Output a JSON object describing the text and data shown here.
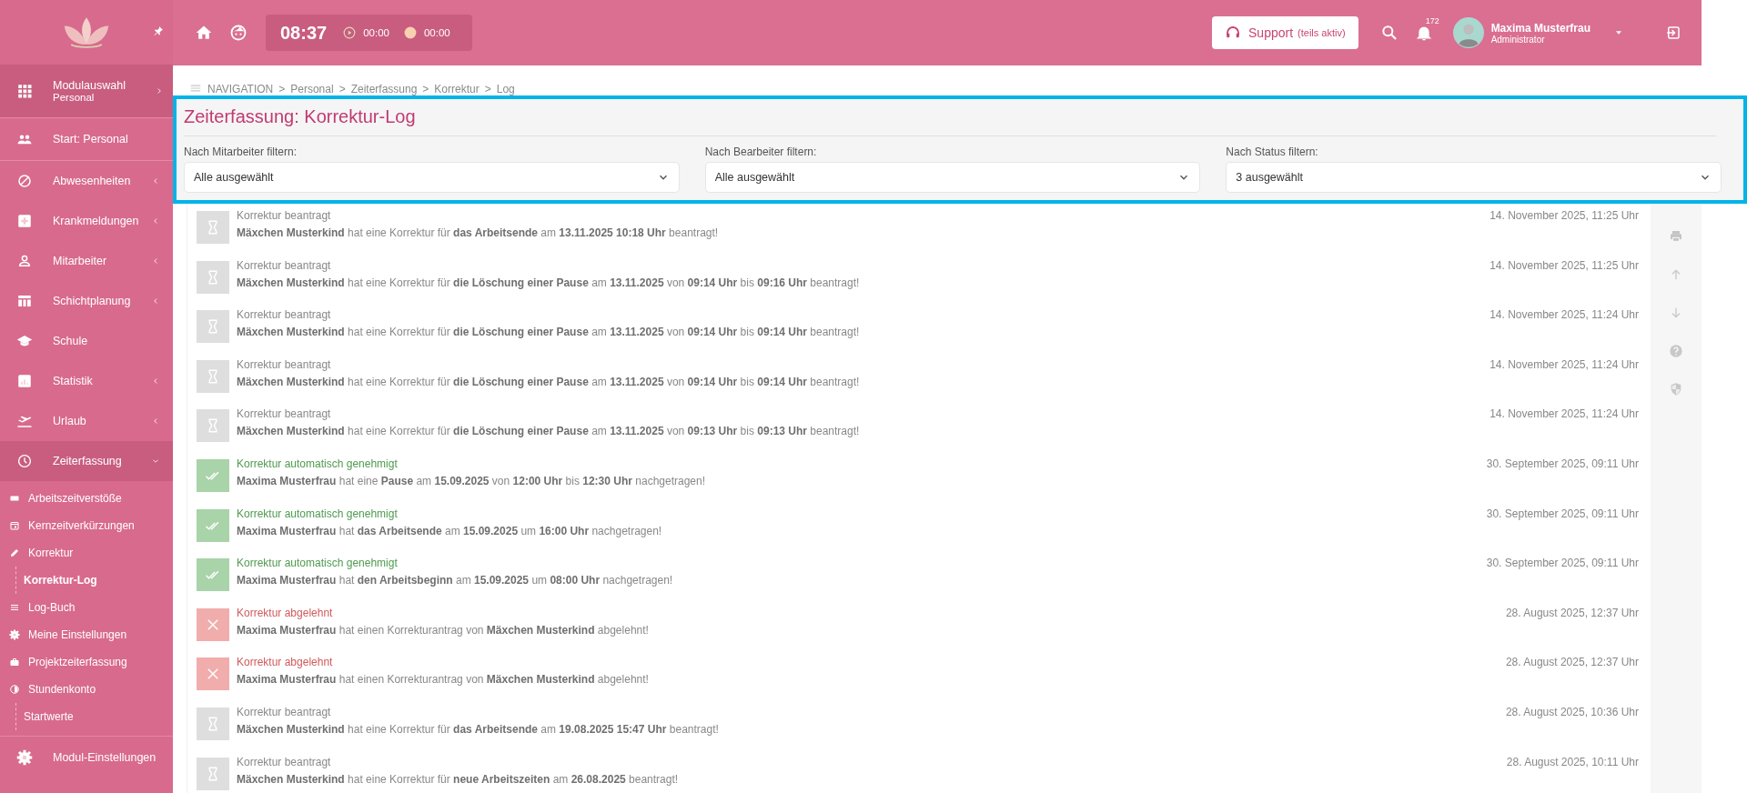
{
  "sidebar": {
    "module": {
      "label": "Modulauswahl",
      "sublabel": "Personal"
    },
    "items": [
      {
        "label": "Start: Personal",
        "expandable": false,
        "expanded": false
      },
      {
        "label": "Abwesenheiten",
        "expandable": true,
        "expanded": false
      },
      {
        "label": "Krankmeldungen",
        "expandable": true,
        "expanded": false
      },
      {
        "label": "Mitarbeiter",
        "expandable": true,
        "expanded": false
      },
      {
        "label": "Schichtplanung",
        "expandable": true,
        "expanded": false
      },
      {
        "label": "Schule",
        "expandable": false,
        "expanded": false
      },
      {
        "label": "Statistik",
        "expandable": true,
        "expanded": false
      },
      {
        "label": "Urlaub",
        "expandable": true,
        "expanded": false
      },
      {
        "label": "Zeiterfassung",
        "expandable": true,
        "expanded": true,
        "children": [
          {
            "label": "Arbeitszeitverstöße",
            "selected": false
          },
          {
            "label": "Kernzeitverkürzungen",
            "selected": false
          },
          {
            "label": "Korrektur",
            "selected": false,
            "children": [
              {
                "label": "Korrektur-Log",
                "selected": true
              }
            ]
          },
          {
            "label": "Log-Buch",
            "selected": false
          },
          {
            "label": "Meine Einstellungen",
            "selected": false
          },
          {
            "label": "Projektzeiterfassung",
            "selected": false
          },
          {
            "label": "Stundenkonto",
            "selected": false,
            "children": [
              {
                "label": "Startwerte",
                "selected": false
              }
            ]
          }
        ]
      }
    ],
    "footer_item": {
      "label": "Modul-Einstellungen"
    }
  },
  "topbar": {
    "clock": "08:37",
    "timers": [
      {
        "kind": "work",
        "value": "00:00"
      },
      {
        "kind": "break",
        "value": "00:00"
      }
    ],
    "support": {
      "label": "Support",
      "note": "(teils aktiv)"
    },
    "notifications": "172",
    "user": {
      "name": "Maxima Musterfrau",
      "role": "Administrator"
    }
  },
  "breadcrumb": {
    "items": [
      "NAVIGATION",
      "Personal",
      "Zeiterfassung",
      "Korrektur",
      "Log"
    ],
    "separator": ">"
  },
  "page_title": "Zeiterfassung: Korrektur-Log",
  "filters": [
    {
      "label": "Nach Mitarbeiter filtern:",
      "value": "Alle ausgewählt"
    },
    {
      "label": "Nach Bearbeiter filtern:",
      "value": "Alle ausgewählt"
    },
    {
      "label": "Nach Status filtern:",
      "value": "3 ausgewählt"
    }
  ],
  "log": [
    {
      "kind": "pending",
      "title": "Korrektur beantragt",
      "message": "**Mäxchen Musterkind** hat eine Korrektur für **das Arbeitsende** am **13.11.2025 10:18 Uhr** beantragt!",
      "date": "14. November 2025, 11:25 Uhr"
    },
    {
      "kind": "pending",
      "title": "Korrektur beantragt",
      "message": "**Mäxchen Musterkind** hat eine Korrektur für **die Löschung einer Pause** am **13.11.2025** von **09:14 Uhr** bis **09:16 Uhr** beantragt!",
      "date": "14. November 2025, 11:25 Uhr"
    },
    {
      "kind": "pending",
      "title": "Korrektur beantragt",
      "message": "**Mäxchen Musterkind** hat eine Korrektur für **die Löschung einer Pause** am **13.11.2025** von **09:14 Uhr** bis **09:14 Uhr** beantragt!",
      "date": "14. November 2025, 11:24 Uhr"
    },
    {
      "kind": "pending",
      "title": "Korrektur beantragt",
      "message": "**Mäxchen Musterkind** hat eine Korrektur für **die Löschung einer Pause** am **13.11.2025** von **09:14 Uhr** bis **09:14 Uhr** beantragt!",
      "date": "14. November 2025, 11:24 Uhr"
    },
    {
      "kind": "pending",
      "title": "Korrektur beantragt",
      "message": "**Mäxchen Musterkind** hat eine Korrektur für **die Löschung einer Pause** am **13.11.2025** von **09:13 Uhr** bis **09:13 Uhr** beantragt!",
      "date": "14. November 2025, 11:24 Uhr"
    },
    {
      "kind": "approved",
      "title": "Korrektur automatisch genehmigt",
      "message": "**Maxima Musterfrau** hat eine **Pause** am **15.09.2025** von **12:00 Uhr** bis **12:30 Uhr** nachgetragen!",
      "date": "30. September 2025, 09:11 Uhr"
    },
    {
      "kind": "approved",
      "title": "Korrektur automatisch genehmigt",
      "message": "**Maxima Musterfrau** hat **das Arbeitsende** am **15.09.2025** um **16:00 Uhr** nachgetragen!",
      "date": "30. September 2025, 09:11 Uhr"
    },
    {
      "kind": "approved",
      "title": "Korrektur automatisch genehmigt",
      "message": "**Maxima Musterfrau** hat **den Arbeitsbeginn** am **15.09.2025** um **08:00 Uhr** nachgetragen!",
      "date": "30. September 2025, 09:11 Uhr"
    },
    {
      "kind": "rejected",
      "title": "Korrektur abgelehnt",
      "message": "**Maxima Musterfrau** hat einen Korrekturantrag von **Mäxchen Musterkind** abgelehnt!",
      "date": "28. August 2025, 12:37 Uhr"
    },
    {
      "kind": "rejected",
      "title": "Korrektur abgelehnt",
      "message": "**Maxima Musterfrau** hat einen Korrekturantrag von **Mäxchen Musterkind** abgelehnt!",
      "date": "28. August 2025, 12:37 Uhr"
    },
    {
      "kind": "pending",
      "title": "Korrektur beantragt",
      "message": "**Mäxchen Musterkind** hat eine Korrektur für **das Arbeitsende** am **19.08.2025 15:47 Uhr** beantragt!",
      "date": "28. August 2025, 10:36 Uhr"
    },
    {
      "kind": "pending",
      "title": "Korrektur beantragt",
      "message": "**Mäxchen Musterkind** hat eine Korrektur für **neue Arbeitszeiten** am **26.08.2025** beantragt!",
      "date": "28. August 2025, 10:11 Uhr"
    }
  ]
}
